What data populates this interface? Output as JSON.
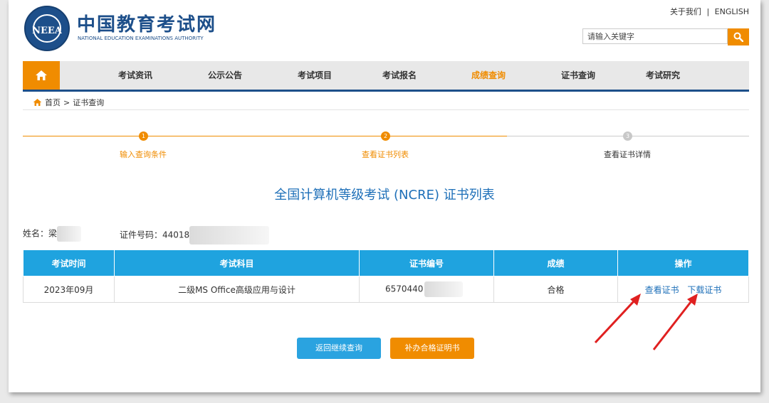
{
  "header": {
    "logo_text": "NEEA",
    "site_name": "中国教育考试网",
    "site_name_en": "NATIONAL EDUCATION EXAMINATIONS AUTHORITY",
    "top_links": [
      "关于我们",
      "|",
      "ENGLISH"
    ],
    "search_placeholder": "请输入关键字"
  },
  "nav": {
    "items": [
      {
        "label": "考试资讯"
      },
      {
        "label": "公示公告"
      },
      {
        "label": "考试项目"
      },
      {
        "label": "考试报名"
      },
      {
        "label": "成绩查询",
        "active": true
      },
      {
        "label": "证书查询"
      },
      {
        "label": "考试研究"
      }
    ]
  },
  "breadcrumb": {
    "home": "首页",
    "sep": ">",
    "current": "证书查询"
  },
  "steps": [
    {
      "num": "1",
      "label": "输入查询条件",
      "state": "done"
    },
    {
      "num": "2",
      "label": "查看证书列表",
      "state": "active"
    },
    {
      "num": "3",
      "label": "查看证书详情",
      "state": "pending"
    }
  ],
  "list_title": "全国计算机等级考试 (NCRE) 证书列表",
  "info": {
    "name_label": "姓名：",
    "name_value": "梁",
    "id_label": "证件号码：",
    "id_value": "44018"
  },
  "table": {
    "headers": [
      "考试时间",
      "考试科目",
      "证书编号",
      "成绩",
      "操作"
    ],
    "rows": [
      {
        "time": "2023年09月",
        "subject": "二级MS Office高级应用与设计",
        "cert_no": "6570440",
        "score": "合格",
        "actions": [
          "查看证书",
          "下载证书"
        ]
      }
    ]
  },
  "buttons": {
    "back": "返回继续查询",
    "reissue": "补办合格证明书"
  },
  "colors": {
    "brand_blue": "#1d4f8a",
    "accent_orange": "#f08c00",
    "table_header": "#1fa3df",
    "link_blue": "#1d6fb8",
    "arrow_red": "#e02020"
  }
}
